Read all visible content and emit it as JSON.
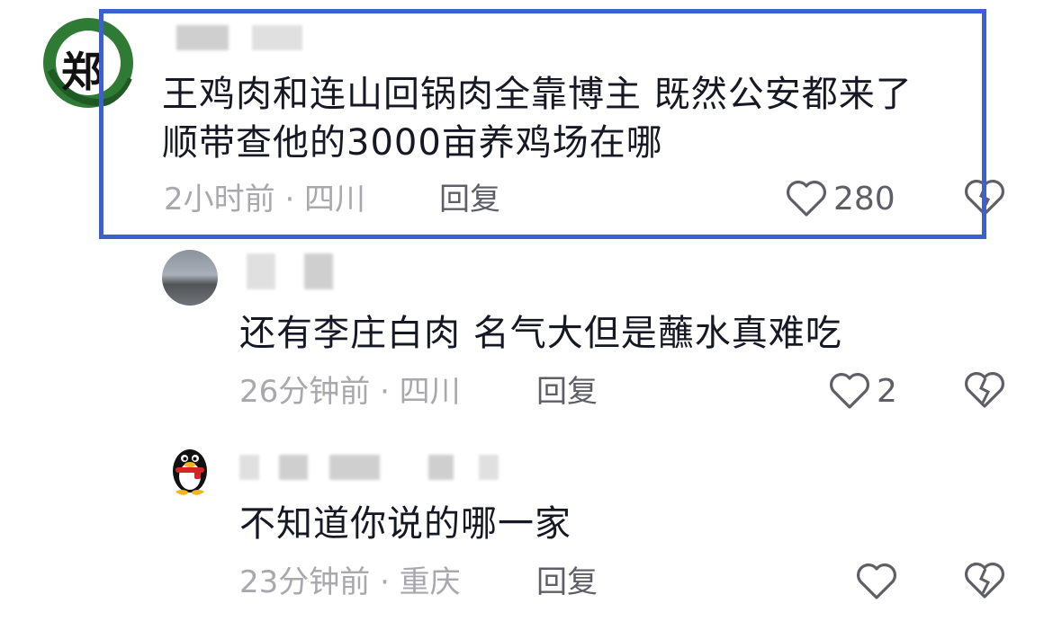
{
  "colors": {
    "highlight_border": "#3f5fd1",
    "text": "#161823",
    "meta": "#a8a8ad",
    "reply": "#5e5e66"
  },
  "comments": [
    {
      "avatar_char": "郑",
      "text_line1": "王鸡肉和连山回锅肉全靠博主  既然公安都来了",
      "text_line2": "顺带查他的3000亩养鸡场在哪",
      "time_location": "2小时前 · 四川",
      "reply_label": "回复",
      "like_count": "280",
      "highlighted": true
    },
    {
      "text_line1": "还有李庄白肉  名气大但是蘸水真难吃",
      "time_location": "26分钟前 · 四川",
      "reply_label": "回复",
      "like_count": "2"
    },
    {
      "text_line1": "不知道你说的哪一家",
      "time_location": "23分钟前 · 重庆",
      "reply_label": "回复",
      "like_count": ""
    }
  ]
}
